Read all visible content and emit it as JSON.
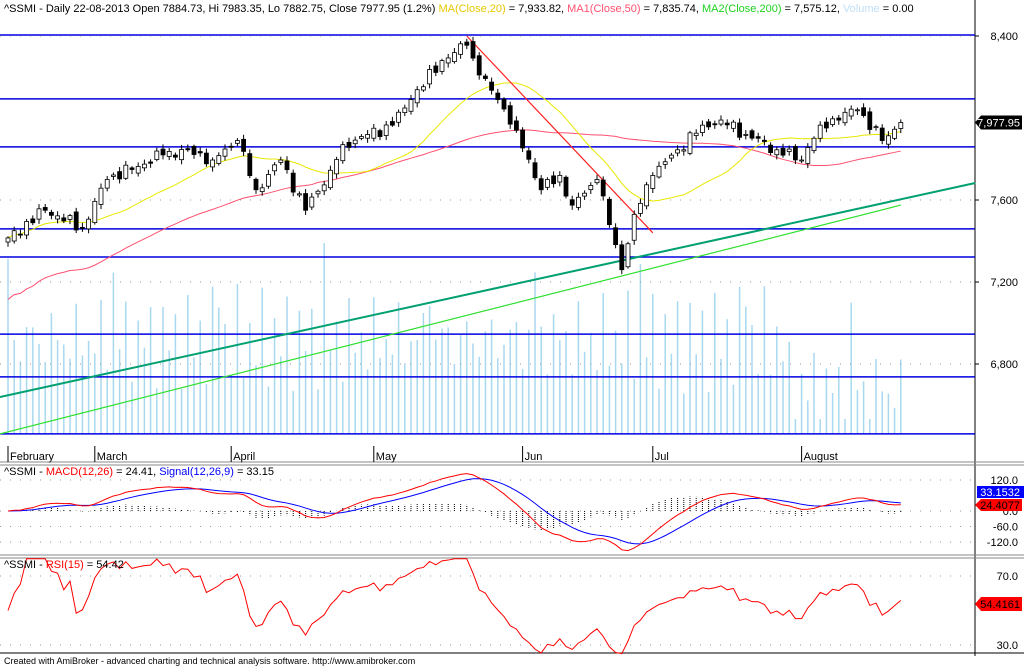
{
  "header": {
    "symbol": "^SSMI - Daily 22-08-2013 Open 7884.73, Hi 7983.35, Lo 7882.75, Close 7977.95 (1.2%)",
    "ma": "MA(Close,20)",
    "ma_val": " = 7,933.82, ",
    "ma1": "MA1(Close,50)",
    "ma1_val": " = 7,835.74, ",
    "ma2": "MA2(Close,200)",
    "ma2_val": " = 7,575.12, ",
    "vol": "Volume",
    "vol_val": " = 0.00"
  },
  "macd_header": {
    "prefix": "^SSMI - ",
    "macd": "MACD(12,26)",
    "macd_val": " = 24.41, ",
    "signal": "Signal(12,26,9)",
    "signal_val": " = 33.15"
  },
  "rsi_header": {
    "prefix": "^SSMI - ",
    "rsi": "RSI(15)",
    "rsi_val": " = 54.42"
  },
  "footer": "Created with AmiBroker - advanced charting and technical analysis software. http://www.amibroker.com",
  "colors": {
    "ma": "#e8e800",
    "ma1": "#ff5070",
    "ma2": "#30e030",
    "trend": "#00a070",
    "resist": "#ff2020",
    "hline": "#0000e0",
    "volume": "#a8d8f0",
    "macd": "#ff0000",
    "signal": "#0000ff",
    "rsi": "#ff0000"
  },
  "chart_data": {
    "type": "candlestick",
    "title": "^SSMI - Daily",
    "price_axis": {
      "ticks": [
        "8,400",
        "7,600",
        "7,200",
        "6,800"
      ],
      "tick_values": [
        8400,
        7600,
        7200,
        6800
      ]
    },
    "last_close_label": "7,977.95",
    "months": [
      {
        "label": "February",
        "index": 0
      },
      {
        "label": "March",
        "index": 14
      },
      {
        "label": "April",
        "index": 36
      },
      {
        "label": "May",
        "index": 59
      },
      {
        "label": "Jun",
        "index": 83
      },
      {
        "label": "Jul",
        "index": 104
      },
      {
        "label": "August",
        "index": 128
      }
    ],
    "close_keyframes": [
      [
        0,
        7415
      ],
      [
        6,
        7550
      ],
      [
        12,
        7463
      ],
      [
        16,
        7700
      ],
      [
        25,
        7820
      ],
      [
        29,
        7845
      ],
      [
        33,
        7795
      ],
      [
        37,
        7890
      ],
      [
        40,
        7650
      ],
      [
        44,
        7795
      ],
      [
        48,
        7550
      ],
      [
        52,
        7745
      ],
      [
        54,
        7870
      ],
      [
        62,
        7965
      ],
      [
        65,
        8090
      ],
      [
        70,
        8280
      ],
      [
        74,
        8355
      ],
      [
        76,
        8210
      ],
      [
        79,
        8090
      ],
      [
        82,
        7940
      ],
      [
        86,
        7650
      ],
      [
        89,
        7720
      ],
      [
        91,
        7575
      ],
      [
        95,
        7700
      ],
      [
        97,
        7480
      ],
      [
        99,
        7260
      ],
      [
        101,
        7530
      ],
      [
        104,
        7720
      ],
      [
        108,
        7845
      ],
      [
        112,
        7965
      ],
      [
        115,
        7990
      ],
      [
        119,
        7920
      ],
      [
        124,
        7845
      ],
      [
        128,
        7795
      ],
      [
        131,
        7965
      ],
      [
        137,
        8040
      ],
      [
        141,
        7890
      ],
      [
        144,
        7977.95
      ]
    ],
    "horizontal_lines": [
      8405,
      8093,
      7859,
      7459,
      7322,
      6946,
      6737,
      6459
    ],
    "trendline": [
      [
        -1.3,
        6639
      ],
      [
        156,
        7683
      ]
    ],
    "ma200_line": [
      [
        -1.3,
        6459
      ],
      [
        144,
        7575.12
      ]
    ],
    "resistance_line": [
      [
        74,
        8400
      ],
      [
        104,
        7440
      ]
    ],
    "macd_axis": {
      "ticks": [
        "120.0",
        "0.0",
        "-60.0",
        "-120.0"
      ],
      "tick_values": [
        120,
        0,
        -60,
        -120
      ]
    },
    "macd_labels": {
      "signal": "33.1532",
      "macd": "24.4077"
    },
    "rsi_axis": {
      "ticks": [
        "70.0",
        "30.0"
      ],
      "tick_values": [
        70,
        30
      ]
    },
    "rsi_label": "54.4161"
  }
}
